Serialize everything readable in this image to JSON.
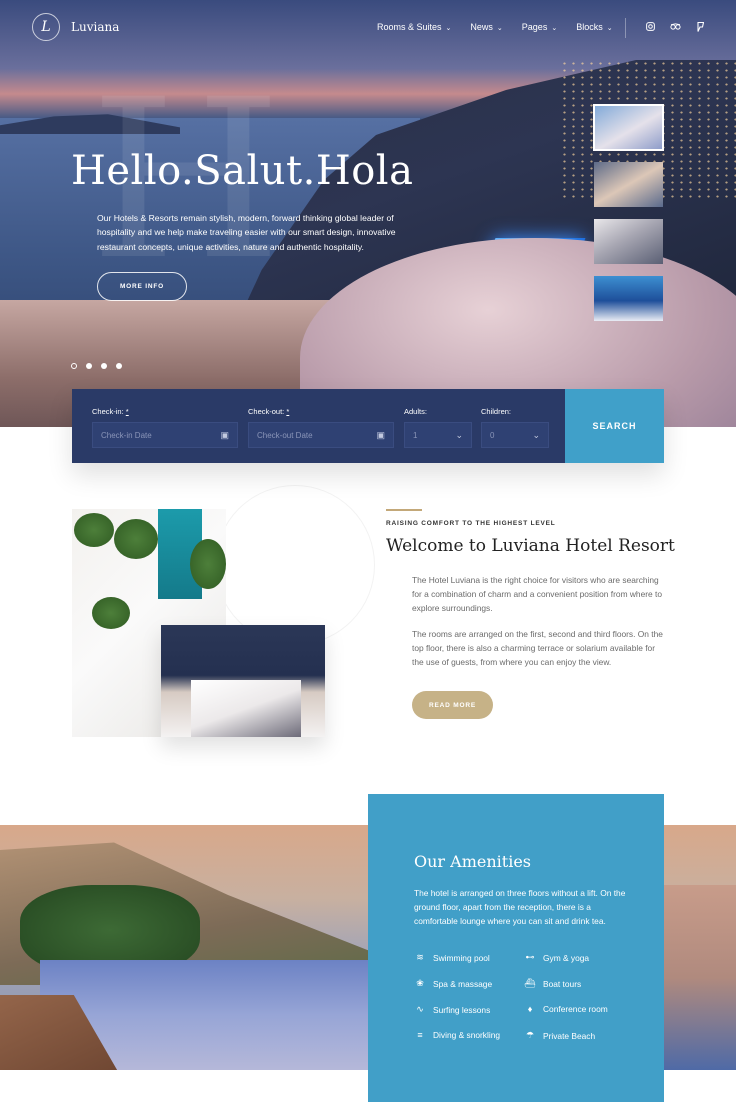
{
  "brand": {
    "name": "Luviana",
    "monogram": "L"
  },
  "nav": {
    "items": [
      {
        "label": "Rooms & Suites"
      },
      {
        "label": "News"
      },
      {
        "label": "Pages"
      },
      {
        "label": "Blocks"
      }
    ],
    "social": [
      "instagram-icon",
      "tripadvisor-icon",
      "foursquare-icon"
    ]
  },
  "hero": {
    "title": "Hello.Salut.Hola",
    "text": "Our Hotels & Resorts remain stylish, modern, forward thinking global leader of hospitality and we help make traveling easier with our smart design, innovative restaurant concepts, unique activities, nature and authentic hospitality.",
    "button": "MORE INFO",
    "slides": 4,
    "active_slide": 1
  },
  "booking": {
    "checkin": {
      "label": "Check-in:",
      "required": "*",
      "placeholder": "Check-in Date"
    },
    "checkout": {
      "label": "Check-out:",
      "required": "*",
      "placeholder": "Check-out Date"
    },
    "adults": {
      "label": "Adults:",
      "value": "1"
    },
    "children": {
      "label": "Children:",
      "value": "0"
    },
    "search": "SEARCH"
  },
  "welcome": {
    "kicker": "RAISING COMFORT TO THE HIGHEST LEVEL",
    "title": "Welcome to Luviana Hotel Resort",
    "p1": "The Hotel Luviana is the right choice for visitors who are searching for a combination of charm and a convenient position from where to explore surroundings.",
    "p2": "The rooms are arranged on the first, second and third floors. On the top floor, there is also a charming terrace or solarium available for the use of guests, from where you can enjoy the view.",
    "button": "READ MORE"
  },
  "amenities": {
    "title": "Our Amenities",
    "text": "The hotel is arranged on three floors without a lift. On the ground floor, apart from the reception, there is a comfortable lounge where you can sit and drink tea.",
    "items": [
      {
        "label": "Swimming pool",
        "icon": "swimming-icon"
      },
      {
        "label": "Gym & yoga",
        "icon": "dumbbell-icon"
      },
      {
        "label": "Spa & massage",
        "icon": "lotus-icon"
      },
      {
        "label": "Boat tours",
        "icon": "boat-icon"
      },
      {
        "label": "Surfing lessons",
        "icon": "wave-icon"
      },
      {
        "label": "Conference room",
        "icon": "microphone-icon"
      },
      {
        "label": "Diving & snorkling",
        "icon": "diving-icon"
      },
      {
        "label": "Private Beach",
        "icon": "umbrella-icon"
      }
    ]
  },
  "colors": {
    "navy": "#2a3a67",
    "accent_blue": "#40a0c9",
    "gold": "#c6b287"
  }
}
